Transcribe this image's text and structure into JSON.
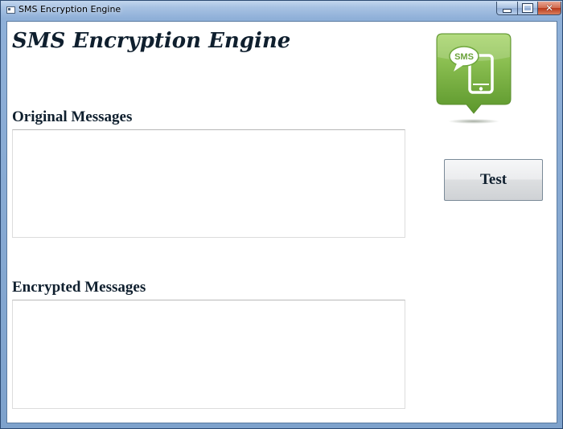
{
  "window": {
    "title": "SMS Encryption Engine",
    "controls": {
      "minimize": "minimize",
      "maximize": "maximize",
      "close": "x"
    }
  },
  "main": {
    "heading": "SMS Encryption Engine",
    "original_label": "Original Messages",
    "original_value": "",
    "encrypted_label": "Encrypted Messages",
    "encrypted_value": "",
    "logo_text": "SMS",
    "test_button_label": "Test"
  },
  "colors": {
    "logo_green_top": "#9ccd5a",
    "logo_green_bottom": "#5f9b2e",
    "heading_text": "#0f1f2e"
  }
}
